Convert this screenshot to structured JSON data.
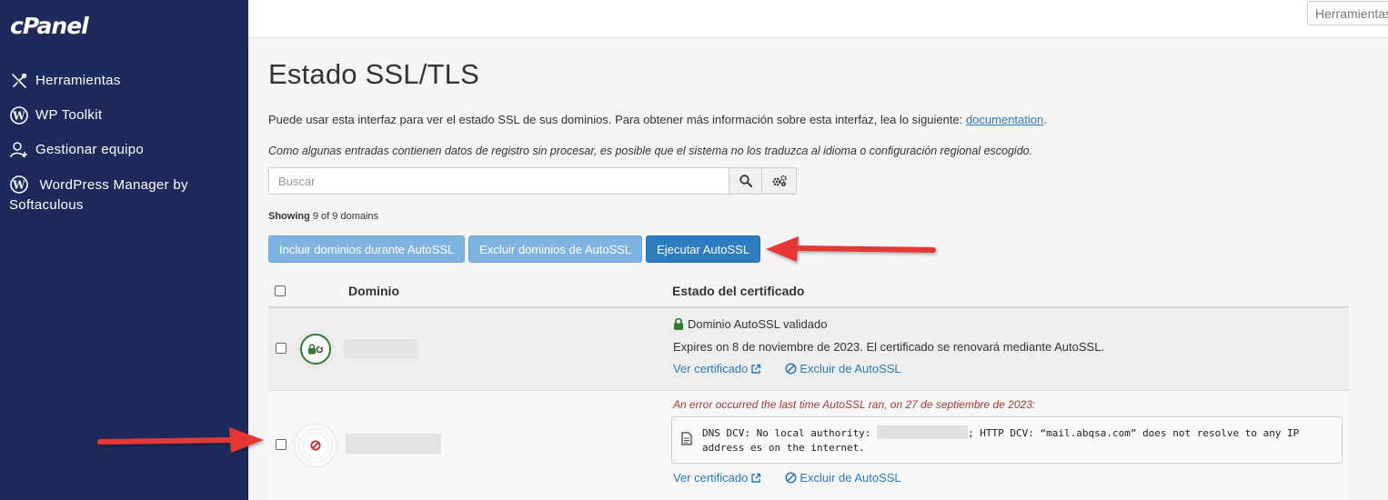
{
  "brand": {
    "logo": "cPanel"
  },
  "sidebar": {
    "items": [
      {
        "label": "Herramientas",
        "icon": "tools-icon"
      },
      {
        "label": "WP Toolkit",
        "icon": "wordpress-icon"
      },
      {
        "label": "Gestionar equipo",
        "icon": "user-plus-icon"
      },
      {
        "label": "WordPress Manager by Softaculous",
        "icon": "wordpress-icon"
      }
    ]
  },
  "topbar": {
    "search_placeholder": "Herramientas"
  },
  "page": {
    "title": "Estado SSL/TLS",
    "intro": "Puede usar esta interfaz para ver el estado SSL de sus dominios. Para obtener más información sobre esta interfaz, lea lo siguiente: ",
    "intro_link": "documentation",
    "intro_end": ".",
    "note": "Como algunas entradas contienen datos de registro sin procesar, es posible que el sistema no los traduzca al idioma o configuración regional escogido."
  },
  "search": {
    "placeholder": "Buscar"
  },
  "showing": {
    "label": "Showing",
    "text": " 9 of 9 domains"
  },
  "actions": {
    "include": "Incluir dominios durante AutoSSL",
    "exclude": "Excluir dominios de AutoSSL",
    "run": "Ejecutar AutoSSL"
  },
  "table": {
    "headers": {
      "domain": "Dominio",
      "status": "Estado del certificado"
    },
    "rows": [
      {
        "status_title": "Dominio AutoSSL validado",
        "expires": "Expires on 8 de noviembre de 2023. El certificado se renovará mediante AutoSSL.",
        "view_cert": "Ver certificado",
        "exclude": "Excluir de AutoSSL"
      },
      {
        "error_title": "An error occurred the last time AutoSSL ran, on 27 de septiembre de 2023:",
        "error_prefix": "DNS DCV: No local authority: ",
        "error_suffix": "; HTTP DCV: “mail.abqsa.com” does not resolve to any IP address es on the internet.",
        "view_cert": "Ver certificado",
        "exclude": "Excluir de AutoSSL"
      }
    ]
  },
  "colors": {
    "sidebar_bg": "#1f2a5c",
    "primary_button": "#2e7dc2",
    "light_button": "#7fb4e2",
    "link": "#2a7ab8",
    "error_text": "#a33a3a",
    "valid_green": "#2e7d32",
    "error_red": "#c62828",
    "arrow_red": "#e53935"
  }
}
